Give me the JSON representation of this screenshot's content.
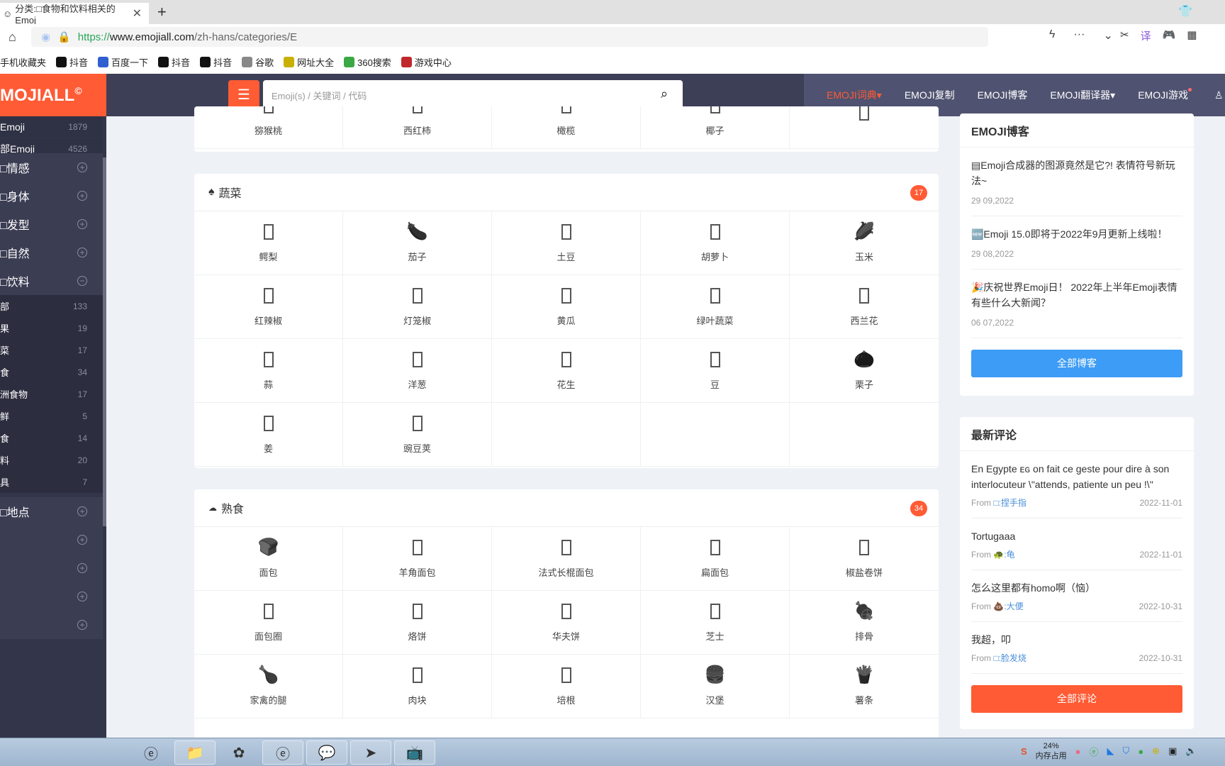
{
  "browser": {
    "tab_title": "分类:□食物和饮料相关的Emoj",
    "url_proto": "https://",
    "url_host": "www.emojiall.com",
    "url_path": "/zh-hans/categories/E",
    "bookmarks": [
      {
        "label": "手机收藏夹",
        "icon": ""
      },
      {
        "label": "抖音",
        "icon": "tiktok-icon"
      },
      {
        "label": "百度一下",
        "icon": "baidu-icon"
      },
      {
        "label": "抖音",
        "icon": "tiktok-icon"
      },
      {
        "label": "抖音",
        "icon": "tiktok-icon"
      },
      {
        "label": "谷歌",
        "icon": "globe-icon"
      },
      {
        "label": "网址大全",
        "icon": "plus-circle-icon"
      },
      {
        "label": "360搜索",
        "icon": "search360-icon"
      },
      {
        "label": "游戏中心",
        "icon": "game-center-icon"
      }
    ]
  },
  "site": {
    "logo": "MOJIALL",
    "logo_mark": "©",
    "search_placeholder": "Emoji(s) / 关键词 / 代码",
    "nav": [
      {
        "label": "EMOJI词典▾",
        "active": true
      },
      {
        "label": "EMOJI复制"
      },
      {
        "label": "EMOJI博客"
      },
      {
        "label": "EMOJI翻译器▾"
      },
      {
        "label": "EMOJI游戏",
        "dot": true
      }
    ],
    "accent": "#ff5b35",
    "header_bg": "#3d3f56"
  },
  "sidebar": {
    "top": [
      {
        "label": "Emoji",
        "count": "1879"
      },
      {
        "label": "部Emoji",
        "count": "4526"
      }
    ],
    "sections_before": [
      "□情感",
      "□身体",
      "□发型",
      "□自然",
      "□饮料"
    ],
    "subitems": [
      {
        "label": "部",
        "count": "133"
      },
      {
        "label": "果",
        "count": "19"
      },
      {
        "label": "菜",
        "count": "17"
      },
      {
        "label": "食",
        "count": "34"
      },
      {
        "label": "洲食物",
        "count": "17"
      },
      {
        "label": "鲜",
        "count": "5"
      },
      {
        "label": "食",
        "count": "14"
      },
      {
        "label": "料",
        "count": "20"
      },
      {
        "label": "具",
        "count": "7"
      }
    ],
    "sections_after": [
      "□地点",
      "",
      "",
      "",
      ""
    ]
  },
  "fruit_tail": [
    {
      "name": "猕猴桃"
    },
    {
      "name": "西红柿"
    },
    {
      "name": "橄榄"
    },
    {
      "name": "椰子"
    },
    {
      "name": ""
    }
  ],
  "vegetables": {
    "title": "蔬菜",
    "count": "17",
    "items": [
      {
        "name": "鳄梨",
        "glyph": "tofu"
      },
      {
        "name": "茄子",
        "glyph": "🍆"
      },
      {
        "name": "土豆",
        "glyph": "tofu"
      },
      {
        "name": "胡萝卜",
        "glyph": "tofu"
      },
      {
        "name": "玉米",
        "glyph": "🌽"
      },
      {
        "name": "红辣椒",
        "glyph": "tofu"
      },
      {
        "name": "灯笼椒",
        "glyph": "tofu"
      },
      {
        "name": "黄瓜",
        "glyph": "tofu"
      },
      {
        "name": "绿叶蔬菜",
        "glyph": "tofu"
      },
      {
        "name": "西兰花",
        "glyph": "tofu"
      },
      {
        "name": "蒜",
        "glyph": "tofu"
      },
      {
        "name": "洋葱",
        "glyph": "tofu"
      },
      {
        "name": "花生",
        "glyph": "tofu"
      },
      {
        "name": "豆",
        "glyph": "tofu"
      },
      {
        "name": "栗子",
        "glyph": "🌰"
      },
      {
        "name": "姜",
        "glyph": "tofu"
      },
      {
        "name": "豌豆荚",
        "glyph": "tofu"
      }
    ]
  },
  "prepared": {
    "title": "熟食",
    "count": "34",
    "items": [
      {
        "name": "面包",
        "glyph": "🍞"
      },
      {
        "name": "羊角面包",
        "glyph": "tofu"
      },
      {
        "name": "法式长棍面包",
        "glyph": "tofu"
      },
      {
        "name": "扁面包",
        "glyph": "tofu"
      },
      {
        "name": "椒盐卷饼",
        "glyph": "tofu"
      },
      {
        "name": "面包圈",
        "glyph": "tofu"
      },
      {
        "name": "烙饼",
        "glyph": "tofu"
      },
      {
        "name": "华夫饼",
        "glyph": "tofu"
      },
      {
        "name": "芝士",
        "glyph": "tofu"
      },
      {
        "name": "排骨",
        "glyph": "🍖"
      },
      {
        "name": "家禽的腿",
        "glyph": "🍗"
      },
      {
        "name": "肉块",
        "glyph": "tofu"
      },
      {
        "name": "培根",
        "glyph": "tofu"
      },
      {
        "name": "汉堡",
        "glyph": "🍔"
      },
      {
        "name": "薯条",
        "glyph": "🍟"
      }
    ]
  },
  "blog": {
    "title": "EMOJI博客",
    "posts": [
      {
        "title": "▤Emoji合成器的图源竟然是它?! 表情符号新玩法~",
        "date": "29 09,2022"
      },
      {
        "title": "🆕Emoji 15.0即将于2022年9月更新上线啦！",
        "date": "29 08,2022"
      },
      {
        "title": "🎉庆祝世界Emoji日！ 2022年上半年Emoji表情有些什么大新闻？",
        "date": "06 07,2022"
      }
    ],
    "button": "全部博客"
  },
  "comments": {
    "title": "最新评论",
    "items": [
      {
        "text": "En Egypte ᴇɢ on fait ce geste pour dire à son interlocuteur \\\"attends, patiente un peu !\\\"",
        "from": "From",
        "user": "□:捏手指",
        "date": "2022-11-01"
      },
      {
        "text": "Tortugaaa",
        "from": "From",
        "user": "🐢:龟",
        "date": "2022-11-01"
      },
      {
        "text": "怎么这里都有homo啊（恼）",
        "from": "From",
        "user": "💩:大便",
        "date": "2022-10-31"
      },
      {
        "text": "我超，叩",
        "from": "From",
        "user": "□:脸发烧",
        "date": "2022-10-31"
      }
    ],
    "button": "全部评论"
  },
  "taskbar": {
    "apps": [
      "ie-icon",
      "file-explorer-icon",
      "360-browser-icon",
      "360-secure-browser-icon",
      "wechat-icon",
      "feishu-icon",
      "bilibili-icon"
    ],
    "mem_percent": "24%",
    "mem_label": "内存占用"
  }
}
